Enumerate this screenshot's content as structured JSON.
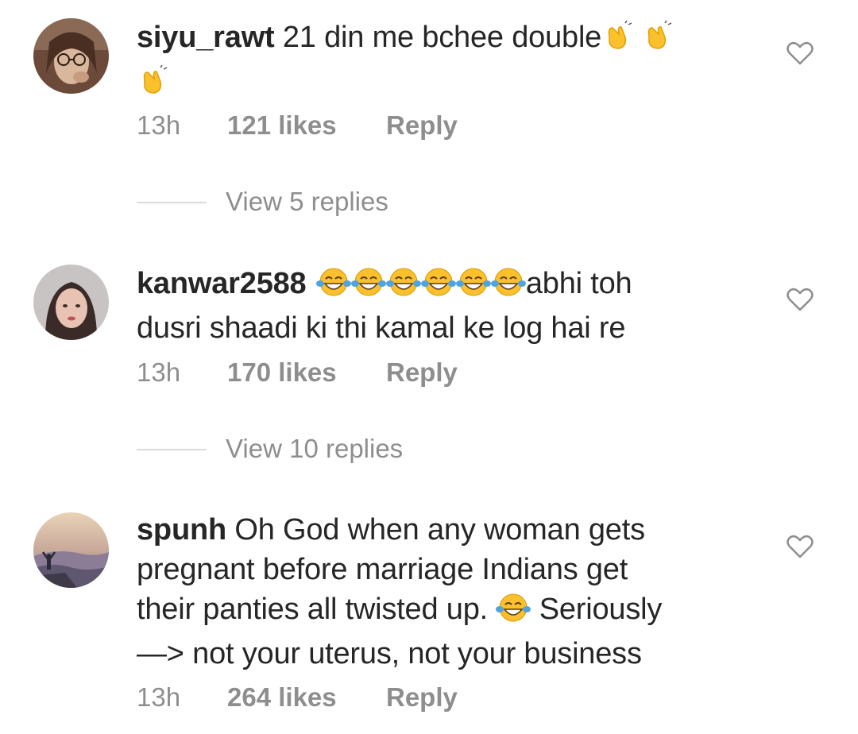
{
  "comments": [
    {
      "username": "siyu_rawt",
      "text_before": " 21 din me bchee double",
      "text_after": "",
      "time": "13h",
      "likes": "121 likes",
      "reply_label": "Reply",
      "view_replies": "View 5 replies",
      "emoji": "clapping-hands-emoji"
    },
    {
      "username": "kanwar2588",
      "text_line1": "abhi toh",
      "text_line2": "dusri shaadi ki thi kamal ke log hai re",
      "time": "13h",
      "likes": "170 likes",
      "reply_label": "Reply",
      "view_replies": "View 10 replies",
      "emoji": "tears-of-joy-emoji"
    },
    {
      "username": "spunh",
      "text_line1": " Oh God when any woman gets",
      "text_line2": "pregnant before marriage Indians get",
      "text_line3a": "their panties all twisted up. ",
      "text_line3b": " Seriously",
      "text_line4": "—> not your uterus, not your business",
      "time": "13h",
      "likes": "264 likes",
      "reply_label": "Reply",
      "emoji": "tears-of-joy-emoji"
    }
  ],
  "colors": {
    "primary_text": "#262626",
    "secondary_text": "#8e8e8e",
    "divider": "#dbdbdb",
    "emoji_yellow": "#fbc02d"
  }
}
